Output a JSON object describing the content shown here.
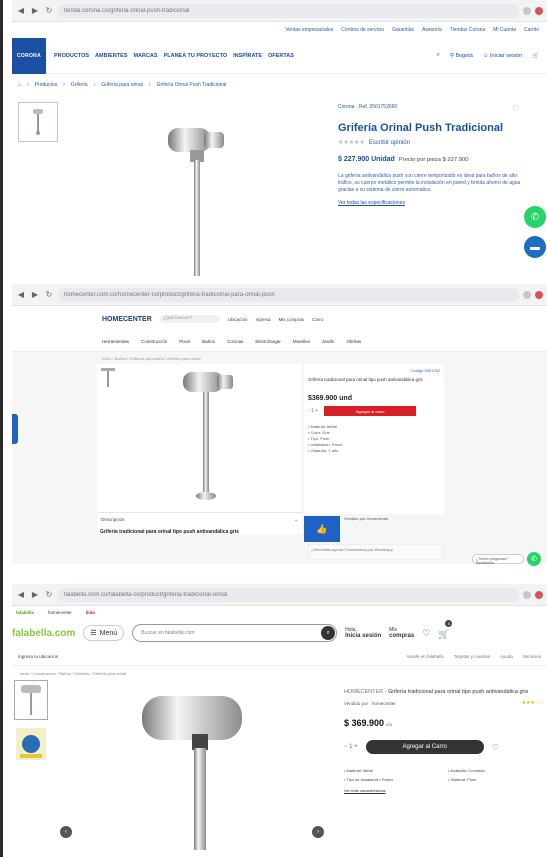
{
  "shot1": {
    "chrome_url": "tienda.corona.co/griferia-orinal-push-tradicional",
    "topbar": [
      "Ventas empresariales",
      "Centros de servicio",
      "Garantías",
      "Asesoría",
      "Tiendas Corona",
      "Mi Cuenta",
      "Carrito"
    ],
    "logo": "CORONA",
    "menu": [
      "PRODUCTOS",
      "AMBIENTES",
      "MARCAS",
      "PLANEA TU PROYECTO",
      "INSPÍRATE",
      "OFERTAS"
    ],
    "location_label": "Bogotá",
    "account_label": "Iniciar sesión",
    "breadcrumb": [
      "Inicio",
      "Productos",
      "Grifería",
      "Grifería para orinal",
      "Grifería Orinal Push Tradicional"
    ],
    "ref": "Corona · Ref. 2501752660",
    "title": "Grifería Orinal Push Tradicional",
    "stars": "★★★★★",
    "rating_label": "Escribir opinión",
    "price": "$ 227.900 Unidad",
    "price_note": "Precio por pieza $ 227.900",
    "description": "La grifería antivandálica push con cierre temporizado es ideal para baños de alto tráfico, su cuerpo metálico permite la instalación en pared y brinda ahorro de agua gracias a su sistema de cierre automático.",
    "link": "Ver todas las especificaciones"
  },
  "shot2": {
    "chrome_url": "homecenter.com.co/homecenter-co/product/griferia-tradicional-para-orinal-push",
    "logo": "HOMECENTER",
    "search_placeholder": "¿Qué buscas?",
    "header_items": [
      "Ubicación",
      "Ingresa",
      "Mis compras",
      "Carro"
    ],
    "categories": [
      "Herramientas",
      "Construcción",
      "Pisos",
      "Baños",
      "Cocinas",
      "Electrohogar",
      "Muebles",
      "Jardín",
      "Ofertas"
    ],
    "breadcrumb": "Inicio / Baños / Griferías para baño / Grifería para orinal",
    "ref": "Código 2501752",
    "title": "Grifería tradicional para orinal tipo push antivandálica gris",
    "price": "$369.900 und",
    "qty": "-  1  +",
    "add_label": "Agregar al carro",
    "specs": [
      "• Material: Metal",
      "• Color: Gris",
      "• Tipo: Push",
      "• Instalación: Pared",
      "• Garantía: 1 año"
    ],
    "seller": "Vendido por Homecenter",
    "desc_tab": "Descripción",
    "desc_heading": "Grifería tradicional para orinal tipo push antivandálica gris",
    "help": "¿Necesitas ayuda? Escríbenos por WhatsApp",
    "wa_pill": "¿Tienes preguntas? Escríbenos"
  },
  "shot3": {
    "chrome_url": "falabella.com.co/falabella-co/product/griferia-tradicional-orinal",
    "promo": [
      "falabella",
      "homecenter",
      "linio"
    ],
    "logo": "falabella.com",
    "menu_label": "Menú",
    "search_placeholder": "Buscar en falabella.com",
    "hi1_small": "Hola,",
    "hi1_big": "Inicia sesión",
    "hi2_small": "Mis",
    "hi2_big": "compras",
    "cart_count": "0",
    "sub_left": "Ingresa tu ubicación",
    "sub_right": [
      "Vende en falabella",
      "Tarjetas y cuentas",
      "Ayuda",
      "Servicios"
    ],
    "breadcrumb": "Inicio / Construcción / Baños / Griferías / Grifería para orinal",
    "brand": "HOMECENTER",
    "title": "Grifería tradicional para orinal tipo push antivandálica gris",
    "seller_label": "Vendido por",
    "seller_name": "homecenter",
    "stars": "★★★☆☆",
    "price": "$ 369.900",
    "price_unit": "c/u",
    "qty": "−  1  +",
    "add_label": "Agregar al Carro",
    "specs": [
      "• Material: Metal",
      "• Acabado: Cromado",
      "• Tipo de instalación: Pared",
      "• Sistema: Push"
    ],
    "more": "Ver más características"
  }
}
